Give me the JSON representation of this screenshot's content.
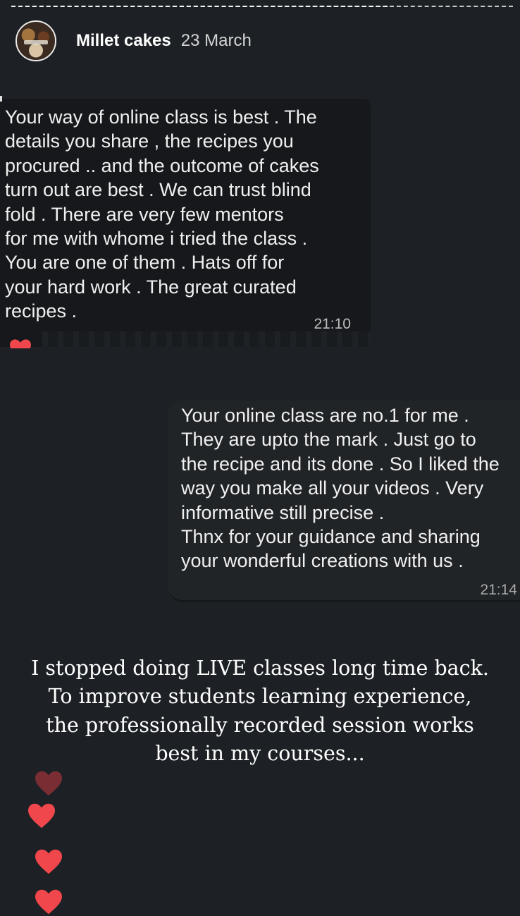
{
  "story": {
    "username": "Millet cakes",
    "date": "23 March"
  },
  "messages": [
    {
      "text": "Your way of online class is best . The\ndetails you share , the recipes you\nprocured .. and the outcome of cakes\nturn out are best . We can trust blind\nfold . There are very few mentors\nfor me with whome i tried the class .\nYou are one of them . Hats off for\nyour hard work . The great curated\nrecipes .",
      "time": "21:10"
    },
    {
      "text": "Your online class are no.1 for me .\nThey are upto the mark . Just go to\nthe recipe and its done . So I liked the\nway you make all your videos . Very\ninformative still precise .\nThnx for your guidance and sharing\nyour wonderful creations with us .",
      "time": "21:14"
    }
  ],
  "caption": "I stopped doing LIVE classes long time back.\nTo improve students learning experience,\nthe professionally recorded session works\nbest in my courses...",
  "icons": {
    "reaction": "heart-icon",
    "floating": [
      "heart-icon",
      "heart-icon",
      "heart-icon",
      "heart-icon"
    ]
  },
  "colors": {
    "background": "#1d2125",
    "heart": "#f0474d",
    "heart_faded": "#7a2e33"
  }
}
